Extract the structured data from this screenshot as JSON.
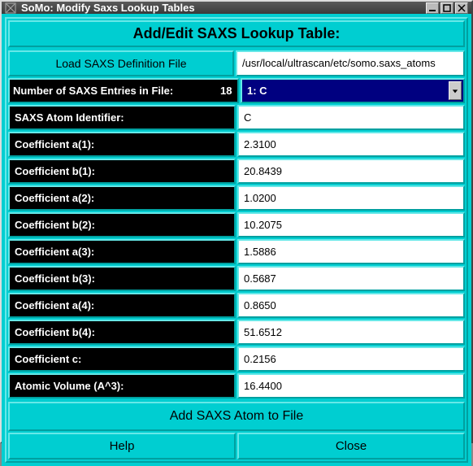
{
  "window": {
    "title": "SoMo: Modify Saxs Lookup Tables"
  },
  "header": "Add/Edit SAXS Lookup Table:",
  "loadBtn": "Load SAXS Definition File",
  "filePath": "/usr/local/ultrascan/etc/somo.saxs_atoms",
  "numEntriesLabel": "Number of SAXS Entries in File:",
  "numEntriesValue": "18",
  "dropdown": {
    "selected": "1: C"
  },
  "fields": [
    {
      "label": "SAXS Atom Identifier:",
      "value": "C"
    },
    {
      "label": "Coefficient a(1):",
      "value": "2.3100"
    },
    {
      "label": "Coefficient b(1):",
      "value": "20.8439"
    },
    {
      "label": "Coefficient a(2):",
      "value": "1.0200"
    },
    {
      "label": "Coefficient b(2):",
      "value": "10.2075"
    },
    {
      "label": "Coefficient a(3):",
      "value": "1.5886"
    },
    {
      "label": "Coefficient b(3):",
      "value": "0.5687"
    },
    {
      "label": "Coefficient a(4):",
      "value": "0.8650"
    },
    {
      "label": "Coefficient b(4):",
      "value": "51.6512"
    },
    {
      "label": "Coefficient c:",
      "value": "0.2156"
    },
    {
      "label": "Atomic Volume (A^3):",
      "value": "16.4400"
    }
  ],
  "addBtn": "Add SAXS Atom to File",
  "helpBtn": "Help",
  "closeBtn": "Close"
}
